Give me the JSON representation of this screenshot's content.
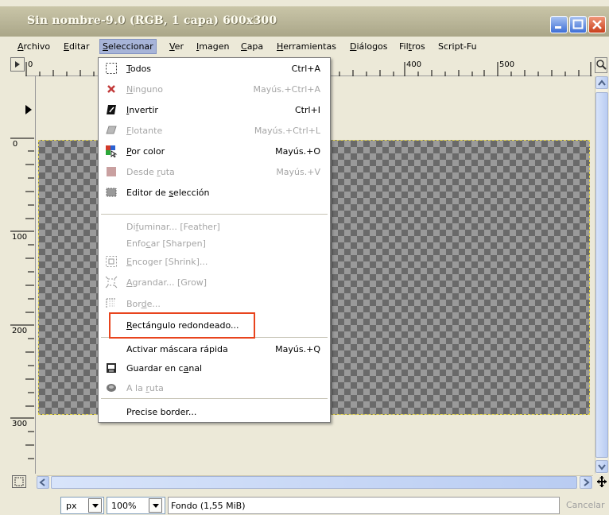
{
  "window": {
    "title": "Sin nombre-9.0 (RGB, 1 capa) 600x300"
  },
  "menubar": {
    "items": [
      {
        "label": "Archivo",
        "u": "A",
        "rest": "rchivo"
      },
      {
        "label": "Editar",
        "u": "E",
        "rest": "ditar"
      },
      {
        "label": "Seleccionar",
        "u": "S",
        "rest": "eleccionar"
      },
      {
        "label": "Ver",
        "u": "V",
        "rest": "er"
      },
      {
        "label": "Imagen",
        "u": "I",
        "rest": "magen"
      },
      {
        "label": "Capa",
        "u": "C",
        "rest": "apa"
      },
      {
        "label": "Herramientas",
        "u": "H",
        "rest": "erramientas"
      },
      {
        "label": "Diálogos",
        "u": "D",
        "rest": "iálogos"
      },
      {
        "label": "Filtros",
        "pre": "Fil",
        "u": "t",
        "rest": "ros"
      },
      {
        "label": "Script-Fu",
        "u": "",
        "rest": "Script-Fu"
      }
    ]
  },
  "ruler": {
    "h_labels": [
      "0",
      "400",
      "500"
    ],
    "v_labels": [
      "0",
      "100",
      "200",
      "300"
    ]
  },
  "select_menu": {
    "items": [
      {
        "label": "Todos",
        "u": "T",
        "rest": "odos",
        "accel": "Ctrl+A",
        "icon": "select-all-icon",
        "disabled": false
      },
      {
        "label": "Ninguno",
        "u": "N",
        "rest": "inguno",
        "accel": "Mayús.+Ctrl+A",
        "icon": "select-none-icon",
        "disabled": true
      },
      {
        "label": "Invertir",
        "u": "I",
        "rest": "nvertir",
        "accel": "Ctrl+I",
        "icon": "invert-selection-icon",
        "disabled": false
      },
      {
        "label": "Flotante",
        "u": "F",
        "rest": "lotante",
        "accel": "Mayús.+Ctrl+L",
        "icon": "float-selection-icon",
        "disabled": true
      },
      {
        "label": "Por color",
        "u": "P",
        "rest": "or color",
        "accel": "Mayús.+O",
        "icon": "select-by-color-icon",
        "disabled": false
      },
      {
        "label": "Desde ruta",
        "pre": "Desde ",
        "u": "r",
        "rest": "uta",
        "accel": "Mayús.+V",
        "icon": "path-to-selection-icon",
        "disabled": true
      },
      {
        "label": "Editor de selección",
        "pre": "Editor de ",
        "u": "s",
        "rest": "elección",
        "accel": "",
        "icon": "selection-editor-icon",
        "disabled": false
      },
      {
        "label": "Difuminar... [Feather]",
        "pre": "Di",
        "u": "f",
        "rest": "uminar... [Feather]",
        "accel": "",
        "icon": "",
        "disabled": true
      },
      {
        "label": "Enfocar [Sharpen]",
        "pre": "Enfo",
        "u": "c",
        "rest": "ar [Sharpen]",
        "accel": "",
        "icon": "",
        "disabled": true
      },
      {
        "label": "Encoger [Shrink]...",
        "u": "E",
        "rest": "ncoger [Shrink]...",
        "accel": "",
        "icon": "shrink-selection-icon",
        "disabled": true
      },
      {
        "label": "Agrandar... [Grow]",
        "u": "A",
        "rest": "grandar... [Grow]",
        "accel": "",
        "icon": "grow-selection-icon",
        "disabled": true
      },
      {
        "label": "Borde...",
        "pre": "Bor",
        "u": "d",
        "rest": "e...",
        "accel": "",
        "icon": "border-selection-icon",
        "disabled": true
      },
      {
        "label": "Rectángulo redondeado...",
        "u": "R",
        "rest": "ectángulo redondeado...",
        "accel": "",
        "icon": "",
        "disabled": false
      },
      {
        "label": "Activar máscara rápida",
        "u": "",
        "rest": "Activar máscara rápida",
        "accel": "Mayús.+Q",
        "icon": "",
        "disabled": false
      },
      {
        "label": "Guardar en canal",
        "pre": "Guardar en c",
        "u": "a",
        "rest": "nal",
        "accel": "",
        "icon": "save-to-channel-icon",
        "disabled": false
      },
      {
        "label": "A la ruta",
        "pre": "A la ",
        "u": "r",
        "rest": "uta",
        "accel": "",
        "icon": "selection-to-path-icon",
        "disabled": true
      },
      {
        "label": "Precise border...",
        "u": "",
        "rest": "Precise border...",
        "accel": "",
        "icon": "",
        "disabled": false
      }
    ]
  },
  "statusbar": {
    "unit": "px",
    "zoom": "100%",
    "status": "Fondo (1,55 MiB)",
    "cancel": "Cancelar"
  },
  "colors": {
    "menu_highlight_box": "#e8441d",
    "checker_dark": "#6a6a6a",
    "checker_light": "#9a9a9a",
    "selection_marquee": "#e8d84a"
  }
}
